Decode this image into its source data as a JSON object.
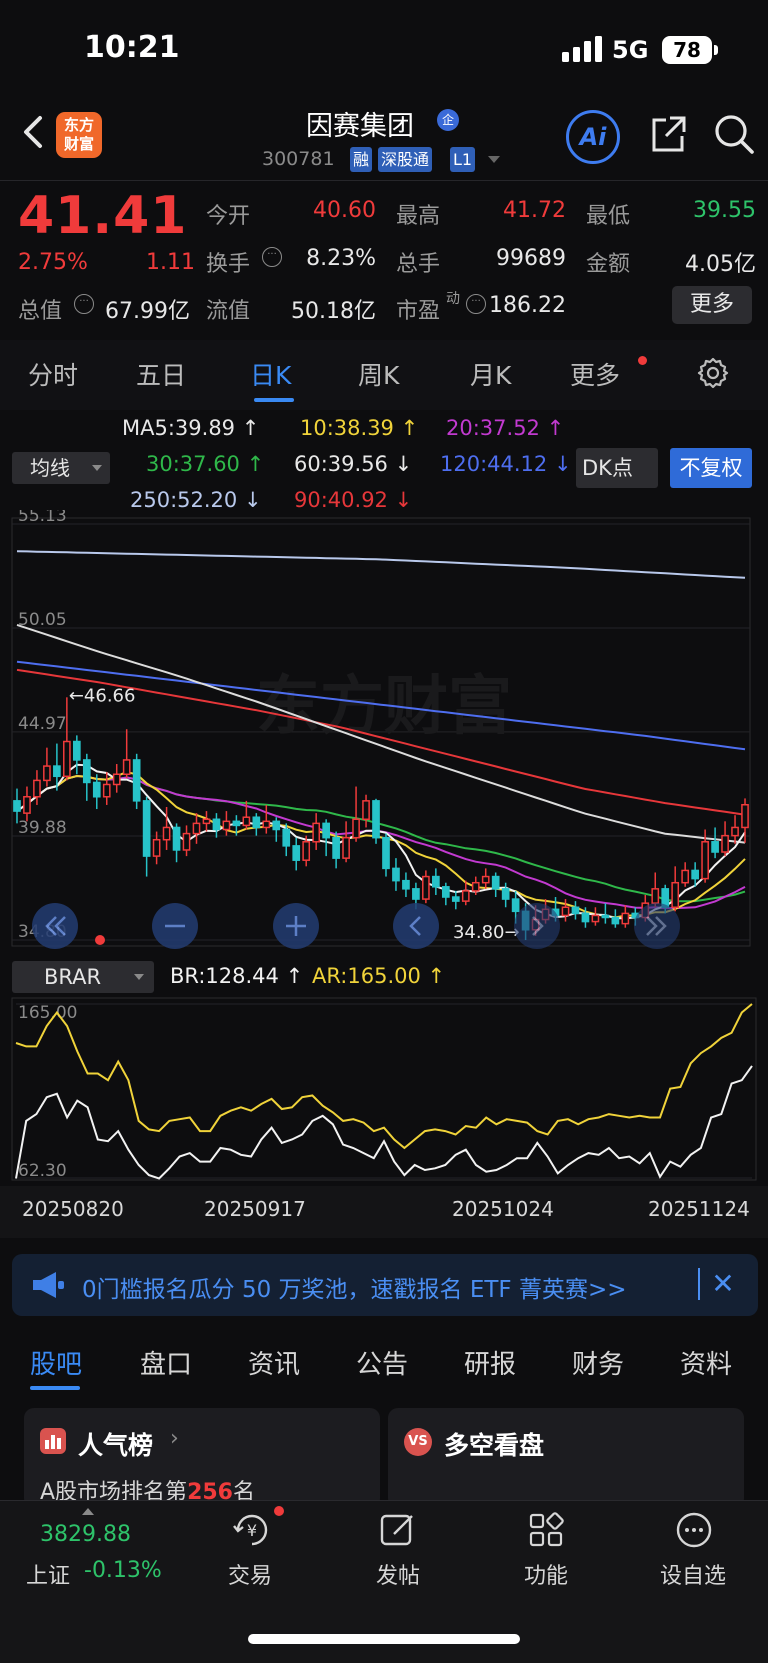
{
  "status_bar": {
    "time": "10:21",
    "network": "5G",
    "battery": "78"
  },
  "header": {
    "logo_text_1": "东方",
    "logo_text_2": "财富",
    "stock_name": "因赛集团",
    "name_badge": "企",
    "stock_code": "300781",
    "tags": [
      "融",
      "深股通",
      "L1"
    ],
    "ai_label": "Ai"
  },
  "quote": {
    "price": "41.41",
    "change_pct": "2.75%",
    "change_amt": "1.11",
    "fields": [
      {
        "label": "今开",
        "value": "40.60",
        "color": "#f03b3b"
      },
      {
        "label": "最高",
        "value": "41.72",
        "color": "#f03b3b"
      },
      {
        "label": "最低",
        "value": "39.55",
        "color": "#2ec36a"
      },
      {
        "label": "换手",
        "value": "8.23%",
        "color": "#e8e8e8"
      },
      {
        "label": "总手",
        "value": "99689",
        "color": "#e8e8e8"
      },
      {
        "label": "金额",
        "value": "4.05亿",
        "color": "#e8e8e8"
      },
      {
        "label": "总值",
        "value": "67.99亿",
        "color": "#e8e8e8"
      },
      {
        "label": "流值",
        "value": "50.18亿",
        "color": "#e8e8e8"
      },
      {
        "label": "市盈",
        "value": "186.22",
        "color": "#e8e8e8"
      }
    ],
    "pe_superscript": "动",
    "more_label": "更多"
  },
  "period_tabs": [
    "分时",
    "五日",
    "日K",
    "周K",
    "月K",
    "更多"
  ],
  "active_period": "日K",
  "indicator": {
    "main_selector": "均线",
    "ma_labels": [
      {
        "text": "MA5:39.89",
        "color": "#e8e8e8",
        "trend": "up"
      },
      {
        "text": "10:38.39",
        "color": "#f0d33a",
        "trend": "up"
      },
      {
        "text": "20:37.52",
        "color": "#c23ad0",
        "trend": "up"
      },
      {
        "text": "30:37.60",
        "color": "#2fb84a",
        "trend": "up"
      },
      {
        "text": "60:39.56",
        "color": "#e8e8e8",
        "trend": "down"
      },
      {
        "text": "120:44.12",
        "color": "#4e6ef0",
        "trend": "down"
      },
      {
        "text": "250:52.20",
        "color": "#b9c9ec",
        "trend": "down"
      },
      {
        "text": "90:40.92",
        "color": "#e6373a",
        "trend": "down"
      }
    ],
    "dk_label": "DK点",
    "adjust_label": "不复权",
    "sub_selector": "BRAR",
    "br_text": "BR:128.44",
    "ar_text": "AR:165.00"
  },
  "chart_data": [
    {
      "type": "candlestick",
      "y_axis_labels": [
        "55.13",
        "50.05",
        "44.97",
        "39.88",
        "34.80"
      ],
      "ylim": [
        34.8,
        55.13
      ],
      "high_marker": "46.66",
      "low_marker": "34.80",
      "watermark": "东方财富",
      "candles": [
        [
          41.6,
          41.1,
          42.2,
          40.5
        ],
        [
          41.0,
          41.8,
          42.3,
          40.6
        ],
        [
          41.8,
          42.6,
          43.1,
          41.4
        ],
        [
          42.6,
          43.3,
          44.2,
          42.3
        ],
        [
          43.3,
          42.8,
          44.4,
          42.1
        ],
        [
          42.8,
          44.5,
          46.66,
          42.6
        ],
        [
          44.5,
          43.6,
          44.8,
          42.9
        ],
        [
          43.6,
          42.5,
          43.9,
          41.6
        ],
        [
          42.5,
          41.8,
          42.9,
          41.2
        ],
        [
          41.8,
          42.4,
          43.0,
          41.4
        ],
        [
          42.4,
          42.9,
          43.4,
          42.0
        ],
        [
          42.9,
          43.6,
          45.1,
          42.7
        ],
        [
          43.6,
          41.6,
          43.9,
          41.2
        ],
        [
          41.6,
          38.9,
          41.8,
          37.9
        ],
        [
          38.9,
          39.7,
          40.1,
          38.5
        ],
        [
          39.7,
          40.3,
          41.3,
          39.2
        ],
        [
          40.3,
          39.2,
          40.5,
          38.6
        ],
        [
          39.2,
          40.0,
          40.4,
          38.9
        ],
        [
          40.0,
          40.5,
          41.0,
          39.5
        ],
        [
          40.5,
          40.7,
          41.1,
          40.1
        ],
        [
          40.7,
          40.2,
          41.0,
          39.8
        ],
        [
          40.2,
          40.6,
          41.1,
          39.9
        ],
        [
          40.6,
          40.4,
          40.9,
          39.9
        ],
        [
          40.4,
          40.8,
          41.6,
          40.2
        ],
        [
          40.8,
          40.3,
          41.0,
          39.9
        ],
        [
          40.3,
          40.6,
          41.4,
          40.0
        ],
        [
          40.6,
          40.2,
          40.8,
          39.6
        ],
        [
          40.2,
          39.4,
          40.5,
          38.9
        ],
        [
          39.4,
          38.7,
          39.8,
          38.2
        ],
        [
          38.7,
          39.6,
          39.9,
          38.4
        ],
        [
          39.6,
          40.5,
          41.0,
          39.2
        ],
        [
          40.5,
          39.8,
          40.7,
          38.9
        ],
        [
          39.8,
          38.8,
          40.1,
          38.3
        ],
        [
          38.8,
          39.8,
          40.6,
          38.6
        ],
        [
          39.8,
          40.7,
          42.3,
          39.6
        ],
        [
          40.7,
          41.6,
          41.9,
          40.3
        ],
        [
          41.6,
          39.8,
          41.7,
          39.5
        ],
        [
          39.8,
          38.3,
          40.0,
          37.9
        ],
        [
          38.3,
          37.7,
          38.8,
          37.2
        ],
        [
          37.7,
          37.3,
          38.1,
          36.9
        ],
        [
          37.3,
          36.8,
          37.6,
          36.3
        ],
        [
          36.8,
          37.9,
          38.2,
          36.6
        ],
        [
          37.9,
          37.4,
          38.3,
          37.0
        ],
        [
          37.4,
          36.9,
          37.6,
          36.5
        ],
        [
          36.9,
          36.7,
          37.2,
          36.3
        ],
        [
          36.7,
          37.2,
          37.7,
          36.5
        ],
        [
          37.2,
          37.6,
          37.9,
          37.0
        ],
        [
          37.6,
          37.9,
          38.3,
          37.3
        ],
        [
          37.9,
          37.3,
          38.1,
          36.9
        ],
        [
          37.3,
          36.8,
          37.6,
          36.4
        ],
        [
          36.8,
          36.2,
          37.2,
          35.6
        ],
        [
          36.2,
          35.3,
          36.6,
          34.8
        ],
        [
          35.3,
          35.8,
          36.5,
          35.0
        ],
        [
          35.8,
          36.3,
          36.8,
          35.6
        ],
        [
          36.3,
          36.0,
          36.9,
          35.7
        ],
        [
          36.0,
          36.4,
          36.8,
          35.7
        ],
        [
          36.4,
          36.1,
          36.7,
          35.8
        ],
        [
          36.1,
          35.7,
          36.4,
          35.4
        ],
        [
          35.7,
          36.0,
          36.4,
          35.5
        ],
        [
          36.0,
          35.9,
          36.6,
          35.6
        ],
        [
          35.9,
          35.6,
          36.3,
          35.4
        ],
        [
          35.6,
          36.1,
          36.5,
          35.4
        ],
        [
          36.1,
          35.9,
          36.4,
          35.5
        ],
        [
          35.9,
          36.6,
          37.0,
          35.7
        ],
        [
          36.6,
          37.3,
          38.1,
          36.4
        ],
        [
          37.3,
          36.4,
          37.5,
          36.1
        ],
        [
          36.4,
          37.6,
          38.4,
          36.2
        ],
        [
          37.6,
          38.2,
          38.6,
          37.4
        ],
        [
          38.2,
          37.8,
          38.6,
          37.4
        ],
        [
          37.8,
          39.6,
          40.2,
          37.6
        ],
        [
          39.6,
          39.1,
          40.3,
          38.8
        ],
        [
          39.1,
          39.9,
          40.6,
          38.9
        ],
        [
          39.9,
          40.3,
          40.9,
          39.5
        ],
        [
          40.3,
          41.41,
          41.72,
          39.55
        ]
      ],
      "ma_lines": {
        "250": [
          53.8,
          53.6,
          53.4,
          53.0,
          52.5
        ],
        "120": [
          48.4,
          47.8,
          47.2,
          46.6,
          46.0,
          45.4,
          44.8,
          44.12
        ],
        "90": [
          48.0,
          47.4,
          46.7,
          46.0,
          45.2,
          44.2,
          43.2,
          42.2,
          41.5,
          40.92
        ],
        "60": [
          50.2,
          48.9,
          47.7,
          46.4,
          45.0,
          43.6,
          42.3,
          41.0,
          40.0,
          39.56
        ]
      }
    },
    {
      "type": "line",
      "y_axis_labels": [
        "165.00",
        "62.30"
      ],
      "ylim": [
        62.3,
        165.0
      ],
      "x_tick_labels": [
        "20250820",
        "20250917",
        "20251024",
        "20251124"
      ],
      "series": [
        {
          "name": "BR",
          "color": "#f2f2f2",
          "values": [
            62,
            96,
            100,
            110,
            112,
            98,
            108,
            104,
            85,
            84,
            90,
            79,
            70,
            64,
            62,
            68,
            75,
            77,
            72,
            72,
            80,
            79,
            76,
            75,
            85,
            92,
            83,
            85,
            88,
            96,
            99,
            94,
            82,
            80,
            77,
            74,
            84,
            72,
            64,
            70,
            67,
            68,
            70,
            76,
            79,
            70,
            66,
            67,
            70,
            74,
            74,
            83,
            75,
            65,
            70,
            74,
            77,
            76,
            80,
            74,
            75,
            71,
            77,
            63,
            72,
            69,
            76,
            80,
            98,
            100,
            118,
            120,
            128.44
          ]
        },
        {
          "name": "AR",
          "color": "#f0d33a",
          "values": [
            142,
            140,
            140,
            152,
            160,
            152,
            137,
            124,
            124,
            120,
            131,
            120,
            96,
            91,
            90,
            96,
            97,
            98,
            90,
            90,
            99,
            102,
            104,
            102,
            106,
            109,
            103,
            104,
            110,
            111,
            105,
            101,
            96,
            97,
            95,
            90,
            92,
            85,
            80,
            85,
            90,
            91,
            90,
            88,
            93,
            92,
            98,
            94,
            97,
            96,
            95,
            90,
            88,
            96,
            97,
            94,
            97,
            98,
            100,
            99,
            98,
            99,
            98,
            98,
            115,
            116,
            130,
            136,
            140,
            145,
            148,
            160,
            165.0
          ]
        }
      ]
    }
  ],
  "banner": {
    "text": "0门槛报名瓜分 50 万奖池，速戳报名 ETF 菁英赛>>"
  },
  "bottom_tabs": [
    "股吧",
    "盘口",
    "资讯",
    "公告",
    "研报",
    "财务",
    "资料"
  ],
  "cards": {
    "left_title": "人气榜",
    "left_sub_prefix": "A股市场排名第",
    "left_rank": "256",
    "left_sub_suffix": "名",
    "right_title": "多空看盘",
    "right_icon": "VS"
  },
  "bottom_nav": {
    "index_value": "3829.88",
    "index_name": "上证",
    "index_change": "-0.13%",
    "items": [
      "交易",
      "发帖",
      "功能",
      "设自选"
    ]
  }
}
